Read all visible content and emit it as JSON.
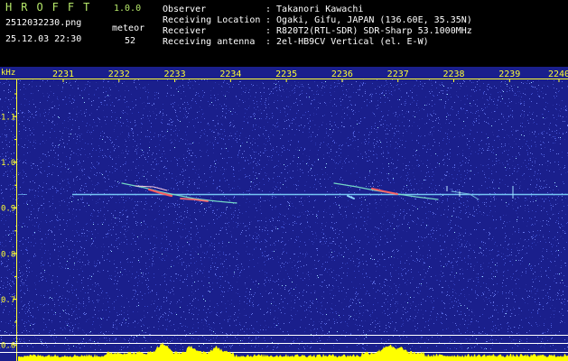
{
  "header": {
    "app_name": "HROFFT",
    "version": "1.0.0",
    "filename": "2512032230.png",
    "datetime": "25.12.03 22:30",
    "meteor_label": "meteor",
    "meteor_count": "52",
    "info_labels": [
      "Observer",
      "Receiving Location",
      "Receiver",
      "Receiving antenna"
    ],
    "info_values": [
      ": Takanori Kawachi",
      ": Ogaki, Gifu, JAPAN (136.60E, 35.35N)",
      ": R820T2(RTL-SDR) SDR-Sharp 53.1000MHz",
      ": 2el-HB9CV Vertical (el. E-W)"
    ]
  },
  "spectrogram": {
    "y_unit": "kHz",
    "time_labels": [
      "2231",
      "2232",
      "2233",
      "2234",
      "2235",
      "2236",
      "2237",
      "2238",
      "2239",
      "2240"
    ],
    "freq_labels": [
      "1.1",
      "1.0",
      "0.9",
      "0.8",
      "0.7",
      "0.6"
    ],
    "colors": {
      "background": "#1a1f8c",
      "axis": "#ffff33",
      "carrier": "#7fd6ff",
      "level": "#ffff00"
    }
  }
}
